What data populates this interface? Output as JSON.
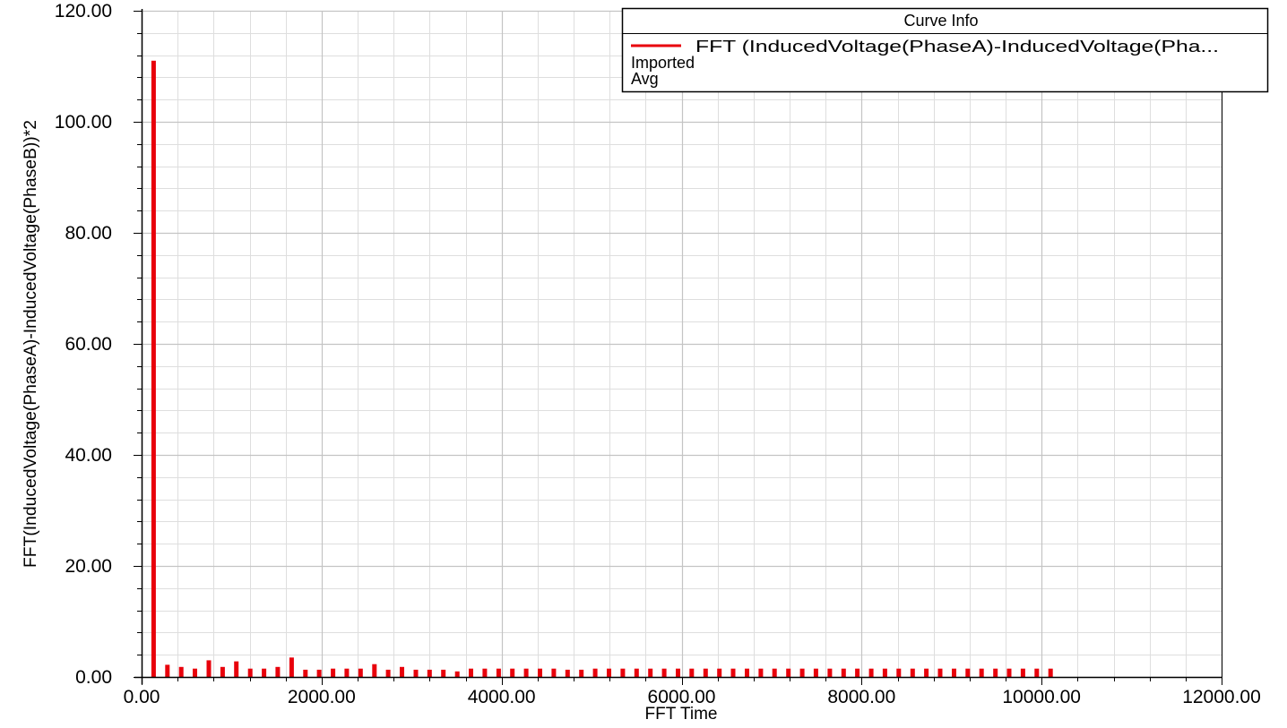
{
  "chart_data": {
    "type": "bar",
    "xlabel": "FFT Time",
    "ylabel": "FFT(InducedVoltage(PhaseA)-InducedVoltage(PhaseB))*2",
    "xlim": [
      0,
      12000
    ],
    "ylim": [
      0,
      120
    ],
    "x_ticks": [
      {
        "value": 0,
        "label": "0.00"
      },
      {
        "value": 2000,
        "label": "2000.00"
      },
      {
        "value": 4000,
        "label": "4000.00"
      },
      {
        "value": 6000,
        "label": "6000.00"
      },
      {
        "value": 8000,
        "label": "8000.00"
      },
      {
        "value": 10000,
        "label": "10000.00"
      },
      {
        "value": 12000,
        "label": "12000.00"
      }
    ],
    "y_ticks": [
      {
        "value": 0,
        "label": "0.00"
      },
      {
        "value": 20,
        "label": "20.00"
      },
      {
        "value": 40,
        "label": "40.00"
      },
      {
        "value": 60,
        "label": "60.00"
      },
      {
        "value": 80,
        "label": "80.00"
      },
      {
        "value": 100,
        "label": "100.00"
      },
      {
        "value": 120,
        "label": "120.00"
      }
    ],
    "grid": true,
    "legend": {
      "title": "Curve Info",
      "placement": "top-right",
      "entries": [
        {
          "label": "FFT (InducedVoltage(PhaseA)-InducedVoltage(Pha...",
          "color": "#e8000b"
        }
      ],
      "lines": [
        "Imported",
        "Avg"
      ]
    },
    "series": [
      {
        "color": "#e8000b",
        "x": [
          133,
          287,
          440,
          593,
          747,
          900,
          1053,
          1207,
          1360,
          1513,
          1667,
          1820,
          1973,
          2127,
          2280,
          2433,
          2587,
          2740,
          2893,
          3047,
          3200,
          3353,
          3507,
          3660,
          3813,
          3967,
          4120,
          4273,
          4427,
          4580,
          4733,
          4887,
          5040,
          5193,
          5347,
          5500,
          5653,
          5807,
          5960,
          6113,
          6267,
          6420,
          6573,
          6727,
          6880,
          7033,
          7187,
          7340,
          7493,
          7647,
          7800,
          7953,
          8107,
          8260,
          8413,
          8567,
          8720,
          8873,
          9027,
          9180,
          9333,
          9487,
          9640,
          9793,
          9947,
          10100
        ],
        "values": [
          111.0,
          2.2,
          1.8,
          1.5,
          3.0,
          1.8,
          2.8,
          1.5,
          1.5,
          1.8,
          3.5,
          1.3,
          1.3,
          1.5,
          1.5,
          1.5,
          2.3,
          1.3,
          1.8,
          1.3,
          1.3,
          1.3,
          1.0,
          1.5,
          1.5,
          1.5,
          1.5,
          1.5,
          1.5,
          1.5,
          1.3,
          1.3,
          1.5,
          1.5,
          1.5,
          1.5,
          1.5,
          1.5,
          1.5,
          1.5,
          1.5,
          1.5,
          1.5,
          1.5,
          1.5,
          1.5,
          1.5,
          1.5,
          1.5,
          1.5,
          1.5,
          1.5,
          1.5,
          1.5,
          1.5,
          1.5,
          1.5,
          1.5,
          1.5,
          1.5,
          1.5,
          1.5,
          1.5,
          1.5,
          1.5,
          1.5
        ]
      }
    ]
  }
}
